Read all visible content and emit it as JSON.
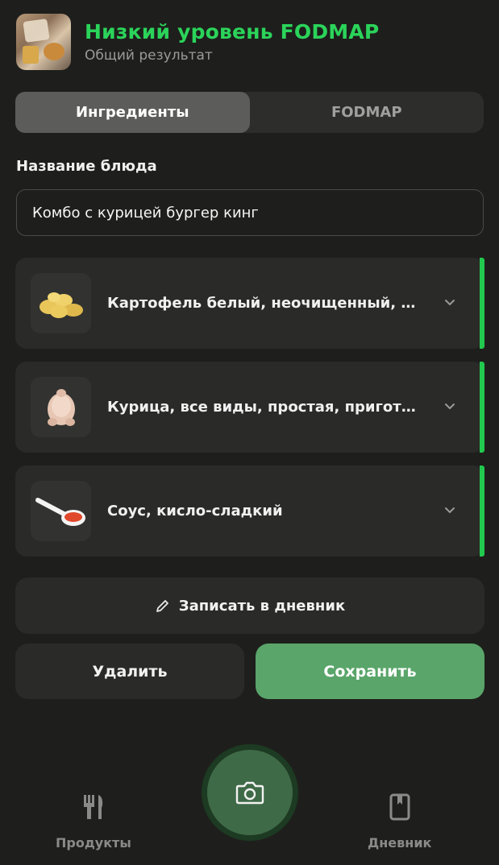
{
  "header": {
    "title": "Низкий уровень FODMAP",
    "subtitle": "Общий результат"
  },
  "tabs": [
    {
      "label": "Ингредиенты",
      "active": true
    },
    {
      "label": "FODMAP",
      "active": false
    }
  ],
  "dish": {
    "label": "Название блюда",
    "value": "Комбо с курицей бургер кинг"
  },
  "ingredients": [
    {
      "name": "Картофель белый, неочищенный, …",
      "icon": "potato-icon",
      "status_color": "#22c94f"
    },
    {
      "name": "Курица, все виды, простая, пригот…",
      "icon": "chicken-icon",
      "status_color": "#22c94f"
    },
    {
      "name": "Соус, кисло-сладкий",
      "icon": "sauce-spoon-icon",
      "status_color": "#22c94f"
    }
  ],
  "actions": {
    "diary_label": "Записать в дневник",
    "delete_label": "Удалить",
    "save_label": "Сохранить"
  },
  "nav": {
    "products_label": "Продукты",
    "diary_label": "Дневник"
  },
  "colors": {
    "accent": "#2bd45a",
    "save": "#5aa56a",
    "background": "#1e1f1c"
  }
}
